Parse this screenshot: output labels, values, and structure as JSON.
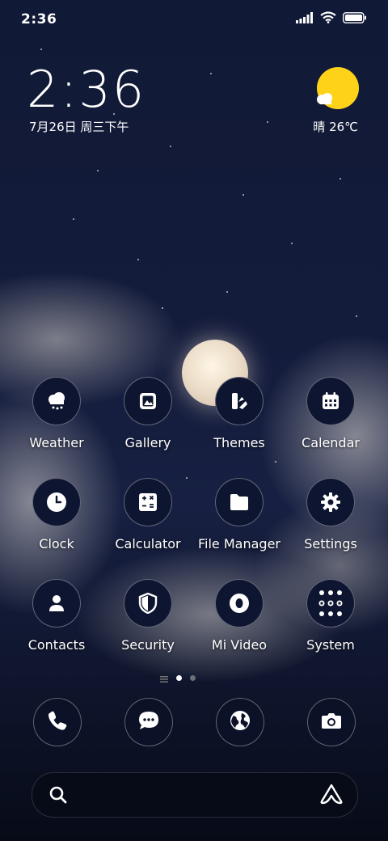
{
  "status_bar": {
    "time": "2:36"
  },
  "lockclock": {
    "time": "2:36",
    "date": "7月26日 周三下午"
  },
  "weather": {
    "text": "晴 26℃",
    "icon": "sunny-cloud-icon"
  },
  "apps": [
    {
      "label": "Weather",
      "icon": "weather-icon"
    },
    {
      "label": "Gallery",
      "icon": "gallery-icon"
    },
    {
      "label": "Themes",
      "icon": "themes-icon"
    },
    {
      "label": "Calendar",
      "icon": "calendar-icon"
    },
    {
      "label": "Clock",
      "icon": "clock-icon"
    },
    {
      "label": "Calculator",
      "icon": "calculator-icon"
    },
    {
      "label": "File Manager",
      "icon": "folder-icon"
    },
    {
      "label": "Settings",
      "icon": "gear-icon"
    },
    {
      "label": "Contacts",
      "icon": "contacts-icon"
    },
    {
      "label": "Security",
      "icon": "shield-icon"
    },
    {
      "label": "Mi Video",
      "icon": "video-icon"
    },
    {
      "label": "System",
      "icon": "folder-grid-icon"
    }
  ],
  "page_indicator": {
    "pages": 2,
    "current": 1
  },
  "dock": [
    {
      "icon": "phone-icon"
    },
    {
      "icon": "messages-icon"
    },
    {
      "icon": "browser-globe-icon"
    },
    {
      "icon": "camera-icon"
    }
  ],
  "search": {
    "icon": "search-icon",
    "assistant_icon": "assistant-icon"
  },
  "colors": {
    "sun": "#ffd21a",
    "icon_bg": "#0e1530"
  }
}
